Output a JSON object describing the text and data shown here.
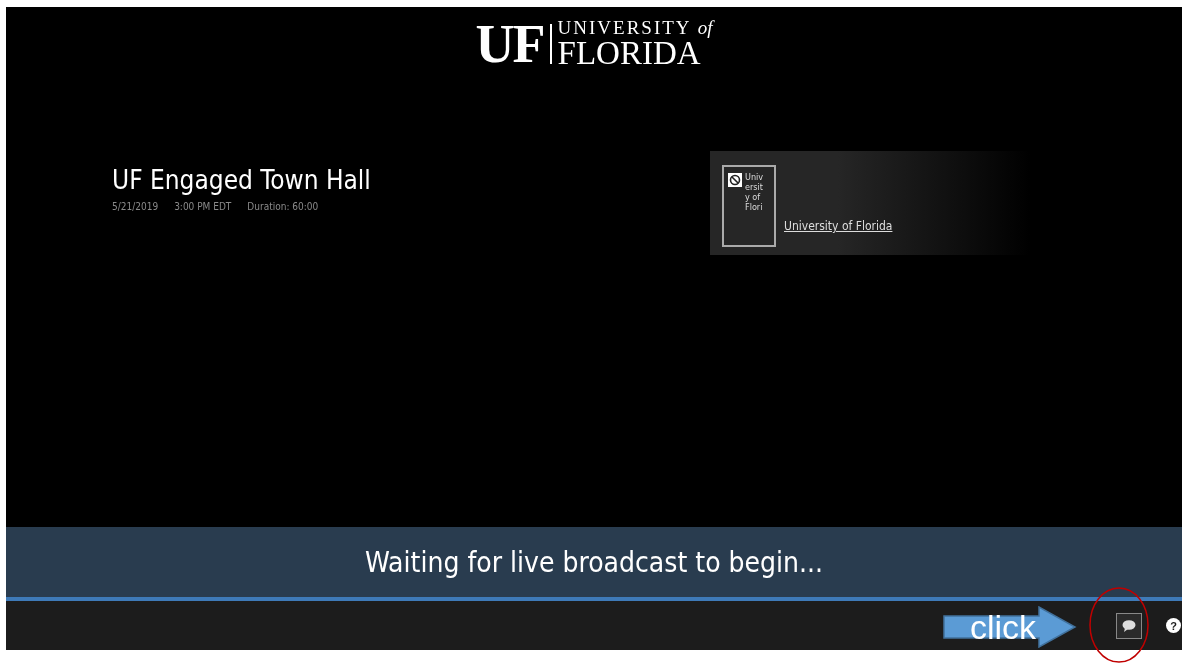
{
  "logo": {
    "mark": "UF",
    "line_1": "UNIVERSITY",
    "line_1_suffix": "of",
    "line_2": "FLORIDA"
  },
  "event": {
    "title": "UF Engaged Town Hall",
    "date": "5/21/2019",
    "time": "3:00 PM EDT",
    "duration": "Duration: 60:00"
  },
  "presenter": {
    "image_alt": "University of Flori",
    "link": "University of Florida"
  },
  "banner": {
    "message": "Waiting for live broadcast to begin..."
  },
  "toolbar": {
    "help": "?"
  },
  "annotation": {
    "label": "click"
  }
}
